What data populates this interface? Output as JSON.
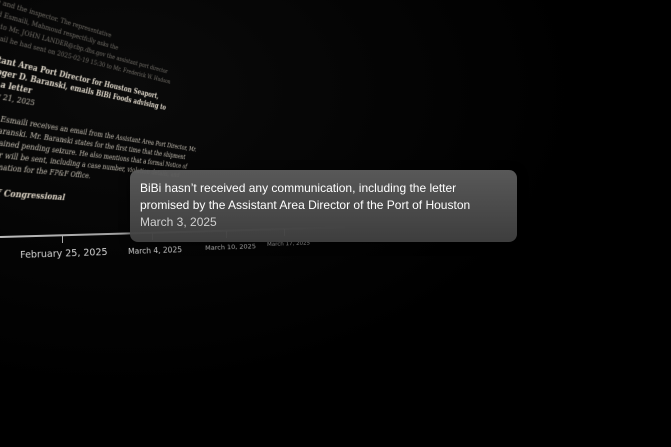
{
  "document": {
    "lines_top": [
      "...e and the inspector. The representative",
      "...ed Esmaili, Mahmoud respectfully asks the",
      "...gs to Mr. JOHN LANDER@cbp.dhs.gov the assistant port director",
      "... email he had sent on 2025-02-19 15:30 to Mr. Frederick W. Hudson"
    ],
    "entry_title": "Assistant Area Port Director for Houston Seaport, Mr. Roger D. Baranski, emails BiBi Foods advising to expect a letter",
    "entry_date": "February 21, 2025",
    "entry_body": [
      "Mahmoud Esmaili receives an email from the Assistant Area Port Director, Mr.",
      "Roger D. Baranski. Mr. Baranski states for the first time that the shipment",
      "remains detained pending seizure. He also mentions that a formal Notice of",
      "Seizure letter will be sent, including a case number, violation details, and",
      "contact information for the FP&F Office."
    ],
    "section_heading": "IP's Office of Congressional"
  },
  "timeline": {
    "labels": [
      "February 25, 2025",
      "March 4, 2025",
      "March 10, 2025",
      "March 17, 2025"
    ]
  },
  "tooltip": {
    "text": "BiBi hasn’t received any communication, including the letter promised by the Assistant Area Director of the Port of Houston",
    "date": "March 3, 2025"
  }
}
